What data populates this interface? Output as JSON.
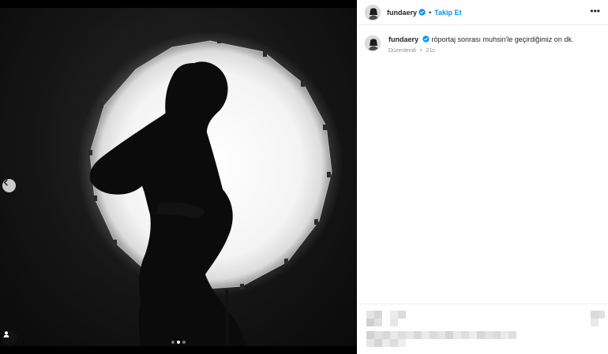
{
  "post": {
    "username": "fundaery",
    "follow_label": "Takip Et",
    "separator": "•",
    "more_label": "•••",
    "caption_username": "fundaery",
    "caption_text": "röportaj sonrası muhsin'le geçirdiğimiz on dk.",
    "edited_label": "Düzenlendi",
    "time_ago": "21s",
    "slides": {
      "count": 3,
      "active_index": 1
    }
  },
  "icons": {
    "verified": "verified-badge-icon",
    "prev": "chevron-left-icon",
    "tag": "user-tag-icon",
    "more": "more-options-icon"
  },
  "colors": {
    "accent": "#0095f6",
    "verified": "#0095f6",
    "text": "#262626",
    "muted": "#8e8e8e"
  }
}
